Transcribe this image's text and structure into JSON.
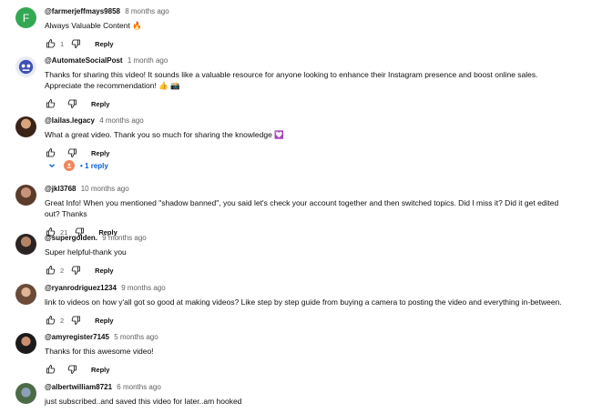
{
  "comments": [
    {
      "avatar_letter": "F",
      "author": "@farmerjeffmays9858",
      "time": "8 months ago",
      "text": "Always Valuable Content 🔥",
      "likes": "1",
      "reply": "Reply"
    },
    {
      "author": "@AutomateSocialPost",
      "time": "1 month ago",
      "text": "Thanks for sharing this video! It sounds like a valuable resource for anyone looking to enhance their Instagram presence and boost online sales. Appreciate the recommendation! 👍 📸",
      "likes": "",
      "reply": "Reply"
    },
    {
      "author": "@lailas.legacy",
      "time": "4 months ago",
      "text": "What a great video. Thank you so much for sharing the knowledge 💟",
      "likes": "",
      "reply": "Reply",
      "replies": "1 reply"
    },
    {
      "author": "@jkl3768",
      "time": "10 months ago",
      "text": "Great Info! When you mentioned \"shadow banned\", you said let's check your account together and then switched topics. Did I miss it? Did it get edited out? Thanks",
      "likes": "21",
      "reply": "Reply"
    },
    {
      "author": "@supergolden.",
      "time": "9 months ago",
      "text": "Super helpful-thank you",
      "likes": "2",
      "reply": "Reply"
    },
    {
      "author": "@ryanrodriguez1234",
      "time": "9 months ago",
      "text": "link to videos on how y'all got so good at making videos? Like step by step guide from buying a camera to posting the video and everything in-between.",
      "likes": "2",
      "reply": "Reply"
    },
    {
      "author": "@amyregister7145",
      "time": "5 months ago",
      "text": "Thanks for this awesome video!",
      "likes": "",
      "reply": "Reply"
    },
    {
      "author": "@albertwilliam8721",
      "time": "6 months ago",
      "text": "just subscribed..and saved this video for later..am hooked",
      "likes": "",
      "reply": ""
    }
  ],
  "icons": {
    "like": "thumb-up-icon",
    "dislike": "thumb-down-icon",
    "expand": "chevron-down-icon"
  },
  "colors": {
    "link": "#065fd4",
    "text": "#0f0f0f",
    "muted": "#606060"
  }
}
